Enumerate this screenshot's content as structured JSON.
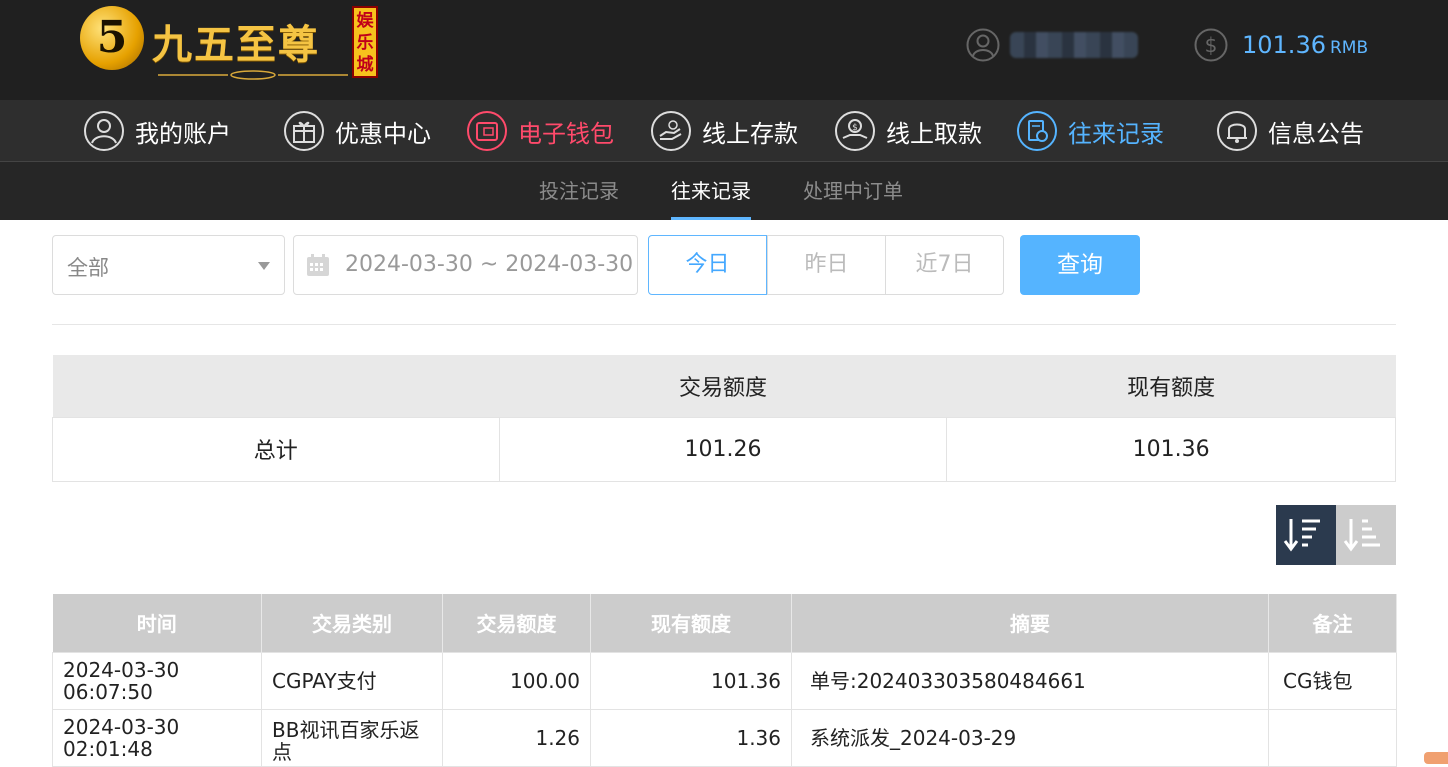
{
  "header": {
    "logo_text": "九五至尊",
    "logo_badge": "娱乐城",
    "logo_digit": "5",
    "balance": "101.36",
    "currency": "RMB"
  },
  "nav": [
    {
      "label": "我的账户",
      "icon": "user-icon"
    },
    {
      "label": "优惠中心",
      "icon": "gift-icon"
    },
    {
      "label": "电子钱包",
      "icon": "wallet-icon"
    },
    {
      "label": "线上存款",
      "icon": "deposit-icon"
    },
    {
      "label": "线上取款",
      "icon": "withdraw-icon"
    },
    {
      "label": "往来记录",
      "icon": "records-icon"
    },
    {
      "label": "信息公告",
      "icon": "bell-icon"
    }
  ],
  "subnav": [
    {
      "label": "投注记录"
    },
    {
      "label": "往来记录"
    },
    {
      "label": "处理中订单"
    }
  ],
  "filters": {
    "type_value": "全部",
    "date_range": "2024-03-30 ~ 2024-03-30",
    "quick": [
      "今日",
      "昨日",
      "近7日"
    ],
    "search_label": "查询"
  },
  "summary": {
    "headers": [
      "",
      "交易额度",
      "现有额度"
    ],
    "row": [
      "总计",
      "101.26",
      "101.36"
    ]
  },
  "records": {
    "headers": [
      "时间",
      "交易类别",
      "交易额度",
      "现有额度",
      "摘要",
      "备注"
    ],
    "rows": [
      [
        "2024-03-30 06:07:50",
        "CGPAY支付",
        "100.00",
        "101.36",
        "单号:202403303580484661",
        "CG钱包"
      ],
      [
        "2024-03-30 02:01:48",
        "BB视讯百家乐返点",
        "1.26",
        "1.36",
        "系统派发_2024-03-29",
        ""
      ]
    ]
  },
  "colors": {
    "accent": "#55b4ff",
    "active_red": "#ff4a6b",
    "header_bg": "#202020",
    "nav_bg": "#2e2e2e",
    "sort_active": "#2b3a4e"
  }
}
